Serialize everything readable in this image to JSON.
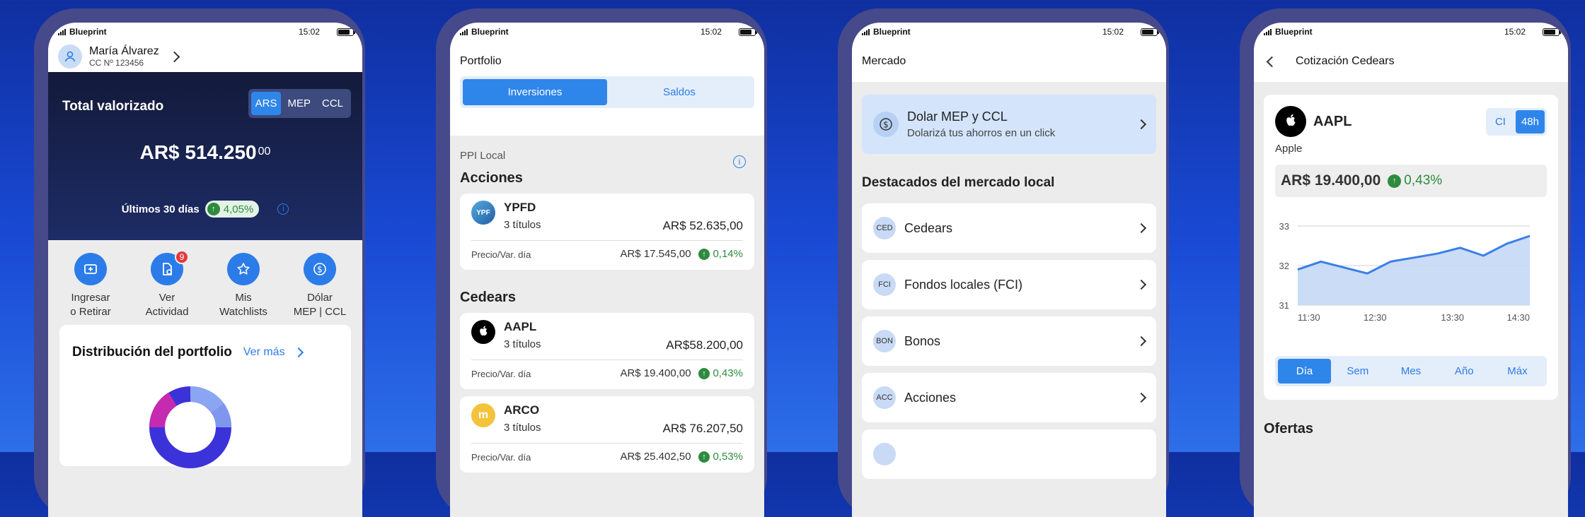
{
  "status": {
    "carrier": "Blueprint",
    "time": "15:02"
  },
  "p1": {
    "user_name": "María Álvarez",
    "user_cc": "CC Nº 123456",
    "total_label": "Total valorizado",
    "currencies": [
      "ARS",
      "MEP",
      "CCL"
    ],
    "amount": "AR$ 514.250",
    "amount_dec": "00",
    "period_label": "Últimos 30 días",
    "period_change": "4,05%",
    "actions": [
      {
        "l1": "Ingresar",
        "l2": "o Retirar",
        "icon": "deposit-icon"
      },
      {
        "l1": "Ver",
        "l2": "Actividad",
        "icon": "activity-icon",
        "badge": "9"
      },
      {
        "l1": "Mis",
        "l2": "Watchlists",
        "icon": "star-icon"
      },
      {
        "l1": "Dólar",
        "l2": "MEP | CCL",
        "icon": "dollar-icon"
      }
    ],
    "dist_title": "Distribución del portfolio",
    "dist_link": "Ver más"
  },
  "p2": {
    "title": "Portfolio",
    "tabs": [
      "Inversiones",
      "Saldos"
    ],
    "section": "PPI Local",
    "group1": "Acciones",
    "group2": "Cedears",
    "price_label": "Precio/Var. día",
    "items": [
      {
        "ticker": "YPFD",
        "titles": "3 títulos",
        "total": "AR$ 52.635,00",
        "price": "AR$ 17.545,00",
        "var": "0,14%",
        "logo": "YPF"
      },
      {
        "ticker": "AAPL",
        "titles": "3 títulos",
        "total": "AR$58.200,00",
        "price": "AR$ 19.400,00",
        "var": "0,43%"
      },
      {
        "ticker": "ARCO",
        "titles": "3 títulos",
        "total": "AR$ 76.207,50",
        "price": "AR$ 25.402,50",
        "var": "0,53%"
      }
    ]
  },
  "p3": {
    "title": "Mercado",
    "promo_title": "Dolar MEP y CCL",
    "promo_sub": "Dolarizá tus ahorros en un click",
    "section": "Destacados del mercado local",
    "items": [
      {
        "abbr": "CED",
        "label": "Cedears"
      },
      {
        "abbr": "FCI",
        "label": "Fondos locales (FCI)"
      },
      {
        "abbr": "BON",
        "label": "Bonos"
      },
      {
        "abbr": "ACC",
        "label": "Acciones"
      }
    ]
  },
  "p4": {
    "title": "Cotización Cedears",
    "ticker": "AAPL",
    "company": "Apple",
    "settle": [
      "CI",
      "48h"
    ],
    "price": "AR$ 19.400,00",
    "change": "0,43%",
    "ranges": [
      "Día",
      "Sem",
      "Mes",
      "Año",
      "Máx"
    ],
    "offers": "Ofertas"
  },
  "chart_data": {
    "type": "area",
    "x": [
      "11:30",
      "",
      "",
      "12:30",
      "",
      "",
      "",
      "13:30",
      "",
      "",
      "14:30"
    ],
    "values": [
      31.9,
      32.1,
      31.95,
      31.8,
      32.1,
      32.2,
      32.3,
      32.45,
      32.25,
      32.55,
      32.75
    ],
    "ylim": [
      31,
      33
    ],
    "yticks": [
      "31",
      "32",
      "33"
    ],
    "xticks": [
      "11:30",
      "12:30",
      "13:30",
      "14:30"
    ],
    "color": "#3b7fe6"
  }
}
